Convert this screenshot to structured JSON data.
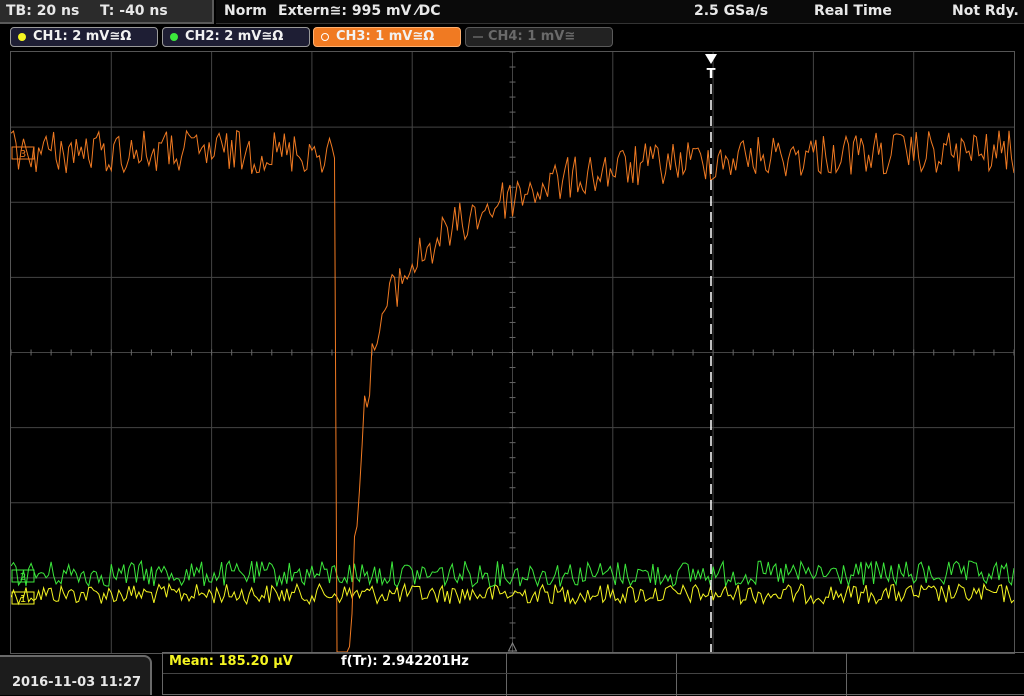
{
  "status": {
    "timebase": "TB: 20 ns",
    "trigger_offset": "T: -40 ns",
    "acq_mode": "Norm",
    "trigger_source": "Extern≅: 995 mV ⁄DC",
    "sample_rate": "2.5 GSa/s",
    "time_mode": "Real Time",
    "trigger_state": "Not Rdy."
  },
  "channels": [
    {
      "label": "CH1: 2 mV≅Ω",
      "color": "#f5f522",
      "state": "on"
    },
    {
      "label": "CH2: 2 mV≅Ω",
      "color": "#3ce83c",
      "state": "on"
    },
    {
      "label": "CH3: 1 mV≅Ω",
      "color": "#f07a22",
      "state": "selected"
    },
    {
      "label": "CH4: 1 mV≅",
      "color": "#555555",
      "state": "off"
    }
  ],
  "screen": {
    "grid_color": "#444444",
    "trigger_marker": "T",
    "channel_markers": {
      "ch1": "1",
      "ch2": "2",
      "ch3": "3"
    }
  },
  "bottom": {
    "datetime": "2016-11-03 11:27",
    "measurements": {
      "mean": "Mean: 185.20 µV",
      "freq": "f(Tr): 2.942201Hz"
    },
    "mean_color": "#f5f522"
  }
}
